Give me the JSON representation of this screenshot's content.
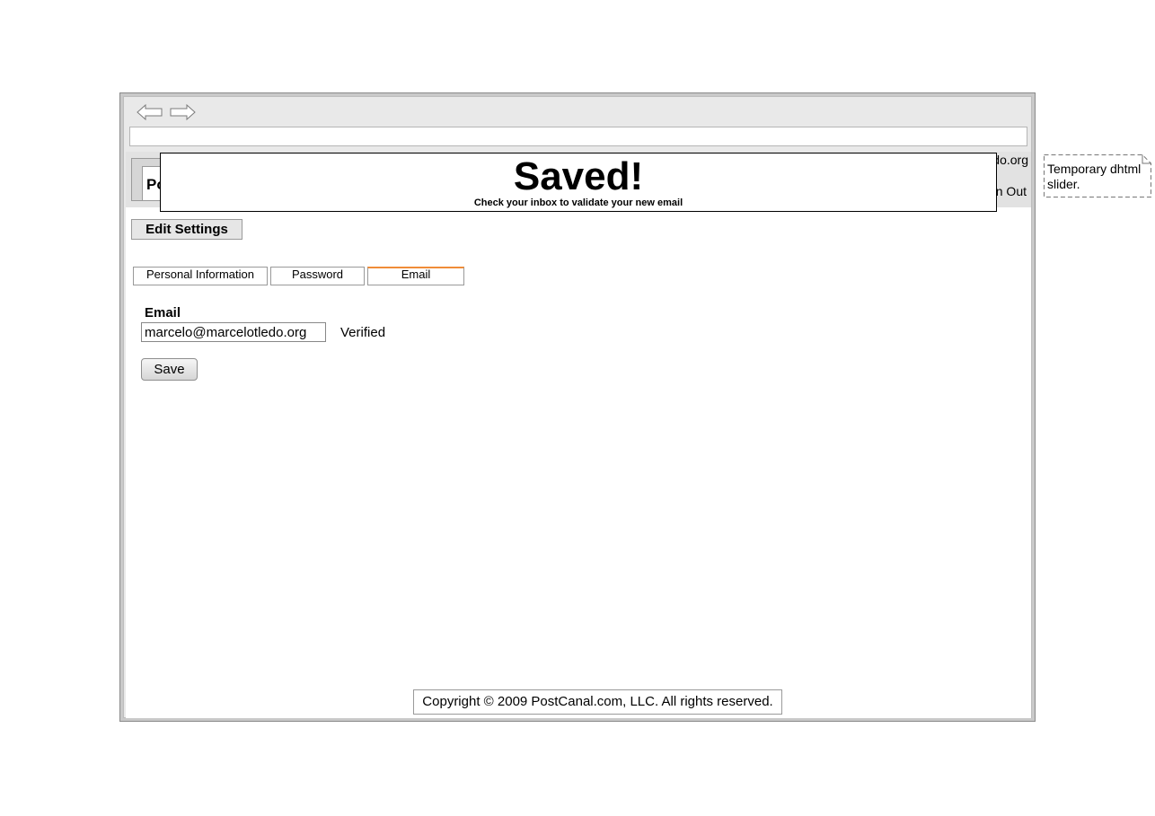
{
  "browser": {
    "back_icon": "arrow-left-icon",
    "forward_icon": "arrow-right-icon",
    "address_value": ""
  },
  "header": {
    "logo_text": "PostCanal",
    "user_email": "marcelo@marcelotledo.org",
    "signout_label": "Sign Out"
  },
  "page": {
    "edit_settings_label": "Edit Settings"
  },
  "tabs": [
    {
      "label": "Personal Information"
    },
    {
      "label": "Password"
    },
    {
      "label": "Email",
      "active": true
    }
  ],
  "form": {
    "email_label": "Email",
    "email_value": "marcelo@marcelotledo.org",
    "status_text": "Verified",
    "save_label": "Save"
  },
  "footer": {
    "copyright": "Copyright © 2009 PostCanal.com, LLC. All rights reserved."
  },
  "notification": {
    "title": "Saved!",
    "message": "Check your inbox to validate your new email"
  },
  "annotation": {
    "text": "Temporary dhtml slider."
  },
  "colors": {
    "active_tab_accent": "#f08c38",
    "header_bg": "#e2e2e2",
    "chrome_bg": "#e9e9e9"
  }
}
